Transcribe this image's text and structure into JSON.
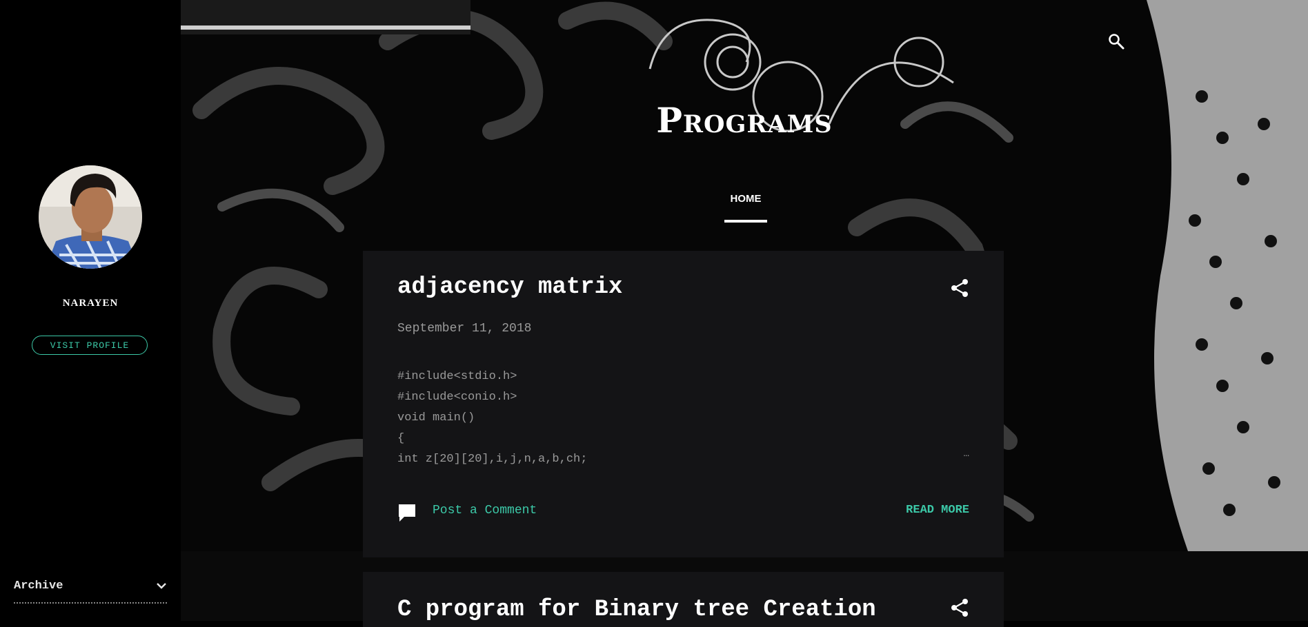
{
  "colors": {
    "accent": "#3cc9a8",
    "background": "#000000",
    "card": "#141416"
  },
  "profile": {
    "name": "NARAYEN",
    "visit_label": "VISIT PROFILE"
  },
  "sidebar": {
    "archive_label": "Archive",
    "archive_icon": "chevron-down-icon"
  },
  "header": {
    "title": "Programs",
    "search_icon": "search-icon"
  },
  "nav": {
    "home_label": "HOME"
  },
  "posts": [
    {
      "title": "adjacency matrix",
      "date": "September 11, 2018",
      "snippet": [
        "#include<stdio.h>",
        "#include<conio.h>",
        "void main()",
        "{",
        "int z[20][20],i,j,n,a,b,ch;"
      ],
      "ellipsis": "…",
      "comment_label": "Post a Comment",
      "read_more": "READ MORE"
    },
    {
      "title": "C program for Binary tree Creation"
    }
  ]
}
